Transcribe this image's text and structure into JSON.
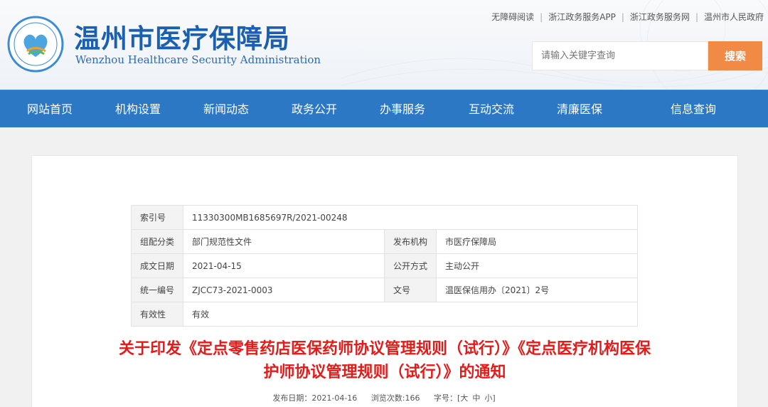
{
  "header": {
    "title": "温州市医疗保障局",
    "subtitle": "Wenzhou Healthcare Security Administration",
    "top_links": [
      "无障碍阅读",
      "浙江政务服务APP",
      "浙江政务服务网",
      "温州市人民政府"
    ],
    "search": {
      "placeholder": "请输入关键字查询",
      "button_label": "搜索"
    }
  },
  "nav": {
    "items": [
      "网站首页",
      "机构设置",
      "新闻动态",
      "政务公开",
      "办事服务",
      "互动交流",
      "清廉医保",
      "信息查询"
    ]
  },
  "meta": {
    "index_no": {
      "label": "索引号",
      "value": "11330300MB1685697R/2021-00248"
    },
    "category": {
      "label": "组配分类",
      "value": "部门规范性文件"
    },
    "publisher": {
      "label": "发布机构",
      "value": "市医疗保障局"
    },
    "date_created": {
      "label": "成文日期",
      "value": "2021-04-15"
    },
    "publish_mode": {
      "label": "公开方式",
      "value": "主动公开"
    },
    "unified_no": {
      "label": "统一编号",
      "value": "ZJCC73-2021-0003"
    },
    "doc_no": {
      "label": "文号",
      "value": "温医保信用办〔2021〕2号"
    },
    "validity": {
      "label": "有效性",
      "value": "有效"
    }
  },
  "document": {
    "title_line1": "关于印发《定点零售药店医保药师协议管理规则（试行）》《定点医疗机构医保",
    "title_line2": "护师协议管理规则（试行）》的通知",
    "publish_date": "发布日期：2021-04-16",
    "views": "浏览次数:166",
    "font_size_label": "字号：[",
    "font_large": "大",
    "font_medium": "中",
    "font_small": "小",
    "font_close": "]"
  },
  "colors": {
    "brand_blue": "#2c78c5",
    "title_blue": "#1a5fb0",
    "search_orange": "#f08a45",
    "doc_title_red": "#e21b1b"
  }
}
